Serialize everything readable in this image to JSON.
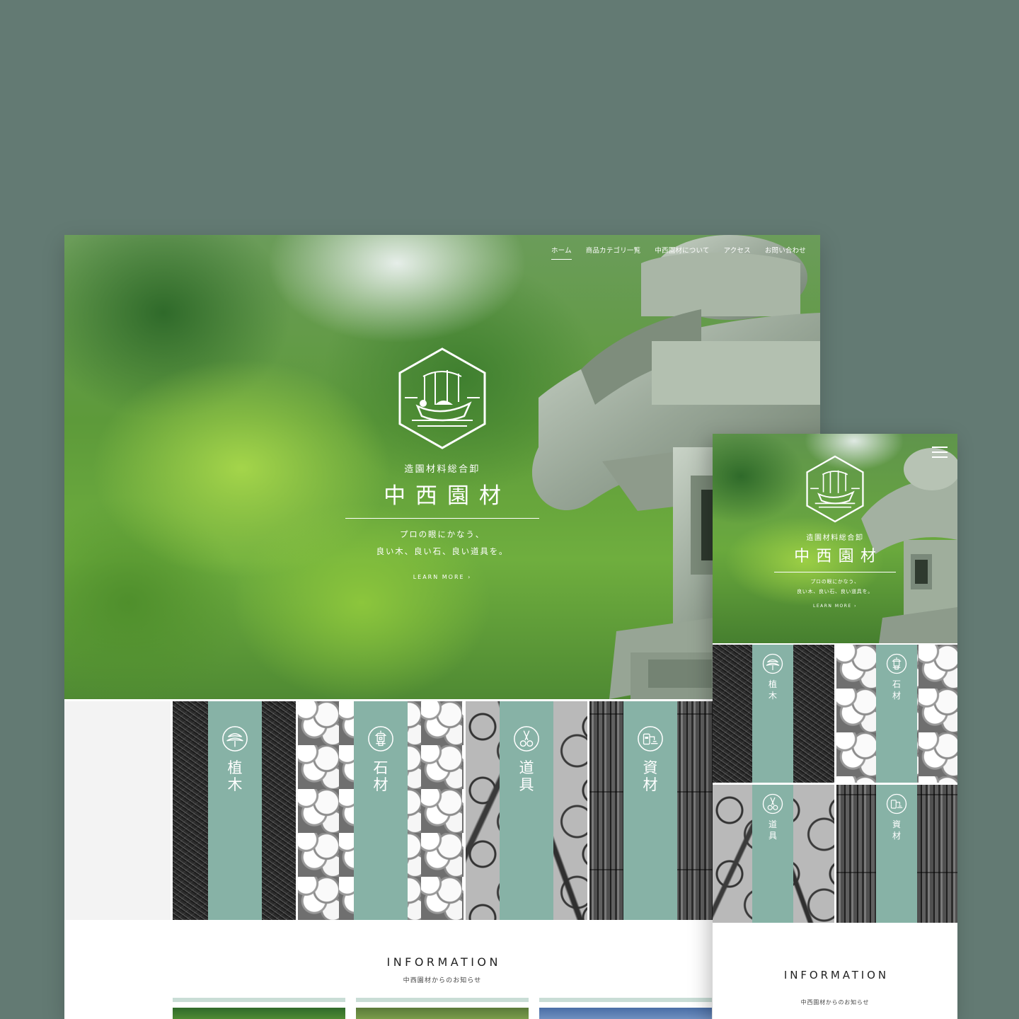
{
  "desktop": {
    "nav": [
      {
        "label": "ホーム",
        "active": true
      },
      {
        "label": "商品カテゴリ一覧"
      },
      {
        "label": "中西園材について"
      },
      {
        "label": "アクセス"
      },
      {
        "label": "お問い合わせ"
      }
    ],
    "hero": {
      "kicker": "造園材料総合卸",
      "name": "中西園材",
      "copy_line1": "プロの眼にかなう、",
      "copy_line2": "良い木、良い石、良い道具を。",
      "learn_more": "LEARN MORE ›"
    },
    "categories": [
      {
        "label": "植木",
        "line1": "植",
        "line2": "木",
        "icon": "pine-tree-icon"
      },
      {
        "label": "石材",
        "line1": "石",
        "line2": "材",
        "icon": "stone-lantern-icon"
      },
      {
        "label": "道具",
        "line1": "道",
        "line2": "具",
        "icon": "shears-icon"
      },
      {
        "label": "資材",
        "line1": "資",
        "line2": "材",
        "icon": "sprayer-icon"
      }
    ],
    "information": {
      "heading": "INFORMATION",
      "subheading": "中西園材からのお知らせ"
    }
  },
  "mobile": {
    "hero": {
      "kicker": "造園材料総合卸",
      "name": "中西園材",
      "copy_line1": "プロの眼にかなう、",
      "copy_line2": "良い木、良い石、良い道具を。",
      "learn_more": "LEARN MORE ›"
    },
    "categories": [
      {
        "line1": "植",
        "line2": "木"
      },
      {
        "line1": "石",
        "line2": "材"
      },
      {
        "line1": "道",
        "line2": "具"
      },
      {
        "line1": "資",
        "line2": "材"
      }
    ],
    "information": {
      "heading": "INFORMATION",
      "subheading": "中西園材からのお知らせ"
    }
  },
  "colors": {
    "background": "#637a73",
    "accent_band": "#87b2a6",
    "info_bar": "#c9ddd6"
  }
}
